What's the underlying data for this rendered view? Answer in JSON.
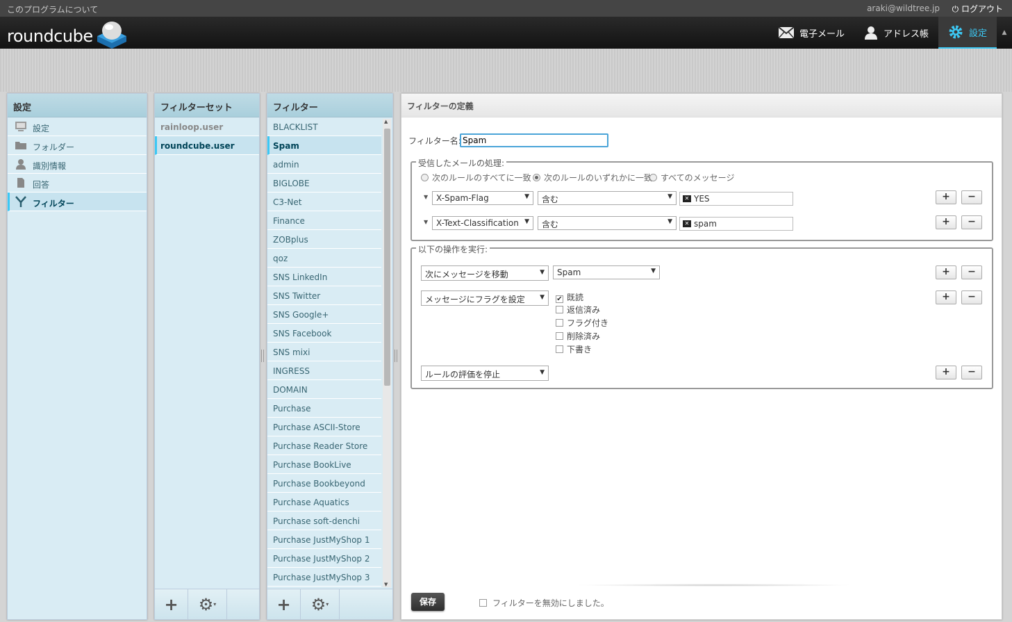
{
  "topline": {
    "about": "このプログラムについて",
    "user": "araki@wildtree.jp",
    "logout": "ログアウト"
  },
  "header": {
    "logo": "roundcube",
    "tasks": {
      "mail": "電子メール",
      "addressbook": "アドレス帳",
      "settings": "設定"
    }
  },
  "settings_panel": {
    "title": "設定",
    "items": [
      {
        "label": "設定",
        "icon": "monitor-icon"
      },
      {
        "label": "フォルダー",
        "icon": "folder-icon"
      },
      {
        "label": "識別情報",
        "icon": "person-icon"
      },
      {
        "label": "回答",
        "icon": "document-icon"
      },
      {
        "label": "フィルター",
        "icon": "filter-icon"
      }
    ]
  },
  "filtersets_panel": {
    "title": "フィルターセット",
    "items": [
      "rainloop.user",
      "roundcube.user"
    ]
  },
  "filters_panel": {
    "title": "フィルター",
    "items": [
      "BLACKLIST",
      "Spam",
      "admin",
      "BIGLOBE",
      "C3-Net",
      "Finance",
      "ZOBplus",
      "qoz",
      "SNS LinkedIn",
      "SNS Twitter",
      "SNS Google+",
      "SNS Facebook",
      "SNS mixi",
      "INGRESS",
      "DOMAIN",
      "Purchase",
      "Purchase ASCII-Store",
      "Purchase Reader Store",
      "Purchase BookLive",
      "Purchase Bookbeyond",
      "Purchase Aquatics",
      "Purchase soft-denchi",
      "Purchase JustMyShop 1",
      "Purchase JustMyShop 2",
      "Purchase JustMyShop 3"
    ]
  },
  "filter_def": {
    "title": "フィルターの定義",
    "name_label": "フィルター名:",
    "name_value": "Spam",
    "rules_legend": "受信したメールの処理:",
    "match_options": [
      "次のルールのすべてに一致",
      "次のルールのいずれかに一致",
      "すべてのメッセージ"
    ],
    "rules": [
      {
        "header": "X-Spam-Flag",
        "op": "含む",
        "value": "YES"
      },
      {
        "header": "X-Text-Classification",
        "op": "含む",
        "value": "spam"
      }
    ],
    "actions_legend": "以下の操作を実行:",
    "actions": {
      "move": {
        "label": "次にメッセージを移動",
        "target": "Spam"
      },
      "flag": {
        "label": "メッセージにフラグを設定",
        "flags": [
          {
            "label": "既読",
            "checked": true
          },
          {
            "label": "返信済み",
            "checked": false
          },
          {
            "label": "フラグ付き",
            "checked": false
          },
          {
            "label": "削除済み",
            "checked": false
          },
          {
            "label": "下書き",
            "checked": false
          }
        ]
      },
      "stop": {
        "label": "ルールの評価を停止"
      }
    },
    "save": "保存",
    "disabled_label": "フィルターを無効にしました。"
  },
  "icons": {
    "add": "+",
    "remove": "−",
    "gear": "⚙"
  }
}
